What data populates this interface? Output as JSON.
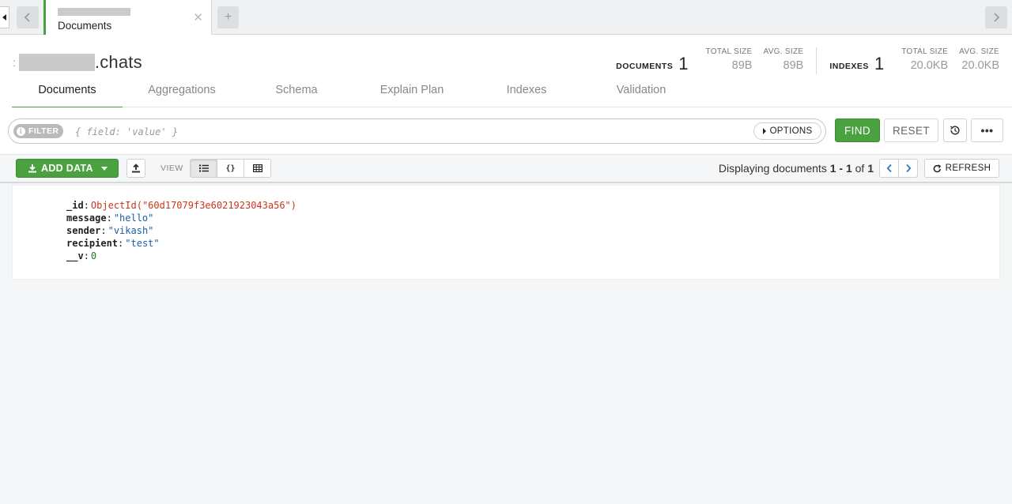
{
  "tabbar": {
    "tab_title": "Documents",
    "close_glyph": "✕",
    "add_glyph": "+"
  },
  "header": {
    "namespace_prefix": ":",
    "collection": ".chats",
    "documents": {
      "label": "DOCUMENTS",
      "count": "1",
      "total_size_label": "TOTAL SIZE",
      "total_size": "89B",
      "avg_size_label": "AVG. SIZE",
      "avg_size": "89B"
    },
    "indexes": {
      "label": "INDEXES",
      "count": "1",
      "total_size_label": "TOTAL SIZE",
      "total_size": "20.0KB",
      "avg_size_label": "AVG. SIZE",
      "avg_size": "20.0KB"
    }
  },
  "subtabs": [
    {
      "label": "Documents",
      "active": true
    },
    {
      "label": "Aggregations"
    },
    {
      "label": "Schema"
    },
    {
      "label": "Explain Plan"
    },
    {
      "label": "Indexes"
    },
    {
      "label": "Validation"
    }
  ],
  "filter": {
    "pill_label": "FILTER",
    "placeholder": "{ field: 'value' }",
    "value": "",
    "options_label": "OPTIONS",
    "find_label": "FIND",
    "reset_label": "RESET",
    "more_label": "•••"
  },
  "toolbar": {
    "add_data_label": "ADD DATA",
    "view_label": "VIEW",
    "view_modes": [
      "list",
      "json",
      "table"
    ],
    "active_view": "list",
    "paging_prefix": "Displaying documents ",
    "paging_range": "1 - 1",
    "paging_of": " of ",
    "paging_total": "1",
    "refresh_label": "REFRESH"
  },
  "document": [
    {
      "key": "_id",
      "value": "ObjectId(\"60d17079f3e6021923043a56\")",
      "type": "oid"
    },
    {
      "key": "message",
      "value": "\"hello\"",
      "type": "str"
    },
    {
      "key": "sender",
      "value": "\"vikash\"",
      "type": "str"
    },
    {
      "key": "recipient",
      "value": "\"test\"",
      "type": "str"
    },
    {
      "key": "__v",
      "value": "0",
      "type": "num"
    }
  ],
  "colors": {
    "accent_green": "#4aa13f",
    "oid_red": "#c8371b",
    "string_blue": "#1a5fa8",
    "number_green": "#1e7b1e"
  },
  "icons": [
    "back-arrow-icon",
    "forward-arrow-icon",
    "close-icon",
    "plus-icon",
    "info-icon",
    "caret-right-icon",
    "history-icon",
    "download-icon",
    "caret-down-icon",
    "upload-icon",
    "list-view-icon",
    "json-view-icon",
    "table-view-icon",
    "chevron-left-icon",
    "chevron-right-icon",
    "refresh-icon"
  ]
}
